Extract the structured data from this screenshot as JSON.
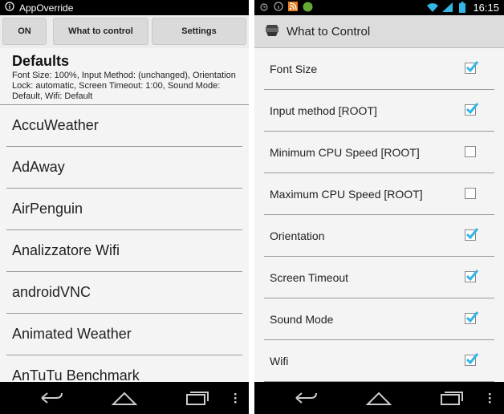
{
  "left": {
    "status_title": "AppOverride",
    "tabs": [
      "ON",
      "What to control",
      "Settings"
    ],
    "defaults_title": "Defaults",
    "defaults_desc": "Font Size: 100%, Input Method: (unchanged), Orientation Lock: automatic, Screen Timeout: 1:00, Sound Mode: Default, Wifi: Default",
    "apps": [
      "AccuWeather",
      "AdAway",
      "AirPenguin",
      "Analizzatore Wifi",
      "androidVNC",
      "Animated Weather",
      "AnTuTu Benchmark"
    ]
  },
  "right": {
    "status_time": "16:15",
    "title": "What to Control",
    "options": [
      {
        "label": "Font Size",
        "checked": true
      },
      {
        "label": "Input method [ROOT]",
        "checked": true
      },
      {
        "label": "Minimum CPU Speed [ROOT]",
        "checked": false
      },
      {
        "label": "Maximum CPU Speed [ROOT]",
        "checked": false
      },
      {
        "label": "Orientation",
        "checked": true
      },
      {
        "label": "Screen Timeout",
        "checked": true
      },
      {
        "label": "Sound Mode",
        "checked": true
      },
      {
        "label": "Wifi",
        "checked": true
      }
    ]
  },
  "icons": [
    "info-icon",
    "alarm-icon",
    "rss-icon",
    "battery-app-icon",
    "wifi-icon",
    "signal-icon",
    "battery-icon",
    "back-icon",
    "home-icon",
    "recents-icon",
    "menu-icon",
    "app-logo-icon",
    "checkmark-icon"
  ],
  "colors": {
    "check": "#33b5e5",
    "statusbar": "#000000",
    "actionbar": "#dcdcdc"
  }
}
